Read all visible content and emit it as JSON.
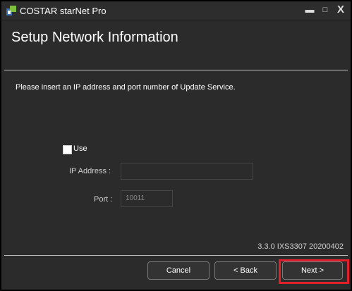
{
  "window": {
    "title": "COSTAR starNet Pro",
    "min_symbol": "▬",
    "max_symbol": "□",
    "close_symbol": "X"
  },
  "header": {
    "title": "Setup Network Information"
  },
  "content": {
    "instruction": "Please insert an IP address and port number of Update Service.",
    "use_label": "Use",
    "use_checked": false,
    "ip_label": "IP Address :",
    "ip_value": "",
    "port_label": "Port :",
    "port_value": "10011",
    "version": "3.3.0 IXS3307 20200402"
  },
  "buttons": {
    "cancel": "Cancel",
    "back": "< Back",
    "next": "Next >"
  },
  "colors": {
    "background": "#2b2b2b",
    "highlight": "#e0202a"
  }
}
